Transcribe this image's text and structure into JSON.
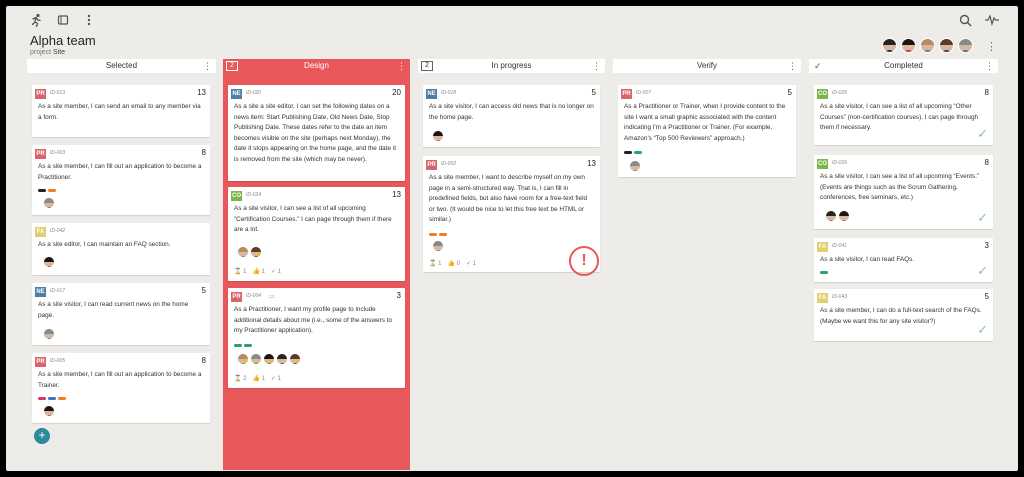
{
  "app": {
    "team_title": "Alpha team",
    "project_label": "project",
    "project_name": "Site"
  },
  "colors": {
    "design_bg": "#e8585b",
    "PR": "#d8656a",
    "NE": "#4e7fa6",
    "CO": "#7ab648",
    "FA": "#dfcf72"
  },
  "icons": {
    "run": "running-person-icon",
    "window": "window-icon",
    "menu": "vertical-dots-icon",
    "search": "search-icon",
    "activity": "activity-pulse-icon",
    "add": "plus-icon",
    "check": "checkmark-icon",
    "alert": "exclamation-icon"
  },
  "columns": [
    {
      "title": "Selected",
      "wip": ""
    },
    {
      "title": "Design",
      "wip": "2"
    },
    {
      "title": "In progress",
      "wip": "2"
    },
    {
      "title": "Verify",
      "wip": ""
    },
    {
      "title": "Completed",
      "wip": ""
    }
  ],
  "cards": {
    "selected": [
      {
        "type": "PR",
        "id": "ID-013",
        "points": "13",
        "text": "As a site member, I can send an email to any member via a form."
      },
      {
        "type": "PR",
        "id": "ID-003",
        "points": "8",
        "text": "As a site member, I can fill out an application to become a Practitioner."
      },
      {
        "type": "FA",
        "id": "ID-042",
        "points": "",
        "text": "As a site editor, I can maintain an FAQ section."
      },
      {
        "type": "NE",
        "id": "ID-017",
        "points": "5",
        "text": "As a site visitor, I can read current news on the home page."
      },
      {
        "type": "PR",
        "id": "ID-005",
        "points": "8",
        "text": "As a site member, I can fill out an application to become a Trainer."
      }
    ],
    "design": [
      {
        "type": "NE",
        "id": "ID-020",
        "points": "20",
        "text": "As a site a site editor, I can set the following dates on a news item: Start Publishing Date, Old News Date, Stop Publishing Date. These dates refer to the date an item becomes visible on the site (perhaps next Monday), the date it stops appearing on the home page, and the date it is removed from the site (which may be never)."
      },
      {
        "type": "CO",
        "id": "ID-024",
        "points": "13",
        "text": "As a site visitor, I can see a list of all upcoming “Certification Courses.” I can page through them if there are a lot.",
        "stats": {
          "hours": "1",
          "likes": "1",
          "done": "1"
        }
      },
      {
        "type": "PR",
        "id": "ID-004",
        "points": "3",
        "text": "As a Practitioner, I want my profile page to include additional details about me (i.e., some of the answers to my Practitioner application).",
        "stats": {
          "hours": "2",
          "likes": "1",
          "done": "1"
        }
      }
    ],
    "inprogress": [
      {
        "type": "NE",
        "id": "ID-018",
        "points": "5",
        "text": "As a site visitor, I can access old news that is no longer on the home page."
      },
      {
        "type": "PR",
        "id": "ID-002",
        "points": "13",
        "text": "As a site member, I want to describe myself on my own page in a semi-structured way. That is, I can fill in predefined fields, but also have room for a free-text field or two. (It would be nice to let this free text be HTML or similar.)",
        "stats": {
          "hours": "1",
          "likes": "0",
          "done": "1"
        }
      }
    ],
    "verify": [
      {
        "type": "PR",
        "id": "ID-007",
        "points": "5",
        "text": "As a Practitioner or Trainer, when I provide content to the site I want a small graphic associated with the content indicating I'm a Practitioner or Trainer. (For example, Amazon's “Top 500 Reviewers” approach.)"
      }
    ],
    "completed": [
      {
        "type": "CO",
        "id": "ID-025",
        "points": "8",
        "text": "As a site visitor, I can see a list of all upcoming “Other Courses” (non-certification courses). I can page through them if necessary."
      },
      {
        "type": "CO",
        "id": "ID-026",
        "points": "8",
        "text": "As a site visitor, I can see a list of all upcoming “Events.” (Events are things such as the Scrum Gathering, conferences, free seminars, etc.)"
      },
      {
        "type": "FA",
        "id": "ID-041",
        "points": "3",
        "text": "As a site visitor, I can read FAQs."
      },
      {
        "type": "FA",
        "id": "ID-043",
        "points": "5",
        "text": "As a site member, I can do a full-text search of the FAQs. (Maybe we want this for any site visitor?)"
      }
    ]
  }
}
